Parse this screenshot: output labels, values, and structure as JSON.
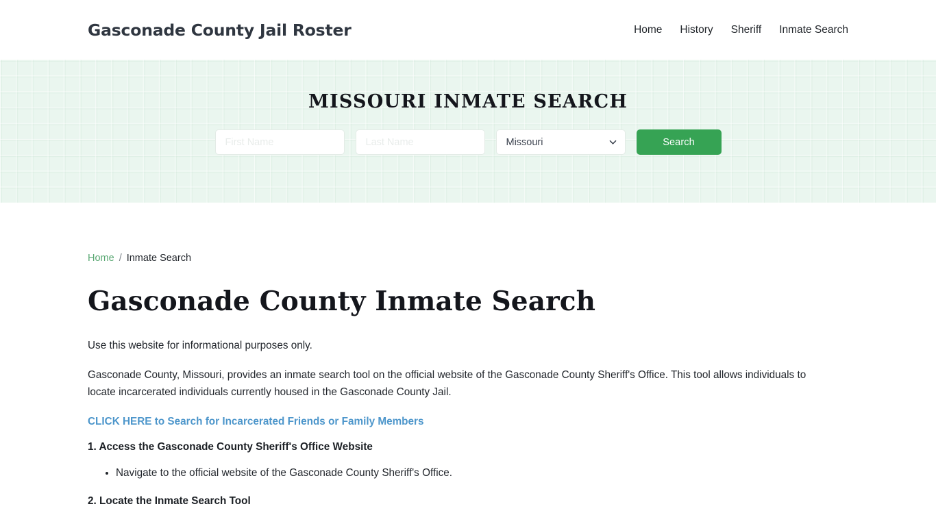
{
  "header": {
    "brand": "Gasconade County Jail Roster",
    "nav": [
      {
        "label": "Home"
      },
      {
        "label": "History"
      },
      {
        "label": "Sheriff"
      },
      {
        "label": "Inmate Search"
      }
    ]
  },
  "hero": {
    "title": "MISSOURI INMATE SEARCH",
    "first_name_placeholder": "First Name",
    "first_name_value": "",
    "last_name_placeholder": "Last Name",
    "last_name_value": "",
    "state_selected": "Missouri",
    "state_options": [
      "Missouri"
    ],
    "search_button": "Search",
    "button_color": "#36a354",
    "background_color": "#eaf6ef"
  },
  "breadcrumb": {
    "home": "Home",
    "separator": "/",
    "current": "Inmate Search",
    "link_color": "#5aa873"
  },
  "main": {
    "page_title": "Gasconade County Inmate Search",
    "paragraph_1": "Use this website for informational purposes only.",
    "paragraph_2": "Gasconade County, Missouri, provides an inmate search tool on the official website of the Gasconade County Sheriff's Office. This tool allows individuals to locate incarcerated individuals currently housed in the Gasconade County Jail.",
    "cta_link": "CLICK HERE to Search for Incarcerated Friends or Family Members",
    "cta_color": "#4d96cb",
    "step_1_heading": "1. Access the Gasconade County Sheriff's Office Website",
    "step_1_bullet_1": "Navigate to the official website of the Gasconade County Sheriff's Office.",
    "step_2_heading": "2. Locate the Inmate Search Tool"
  }
}
